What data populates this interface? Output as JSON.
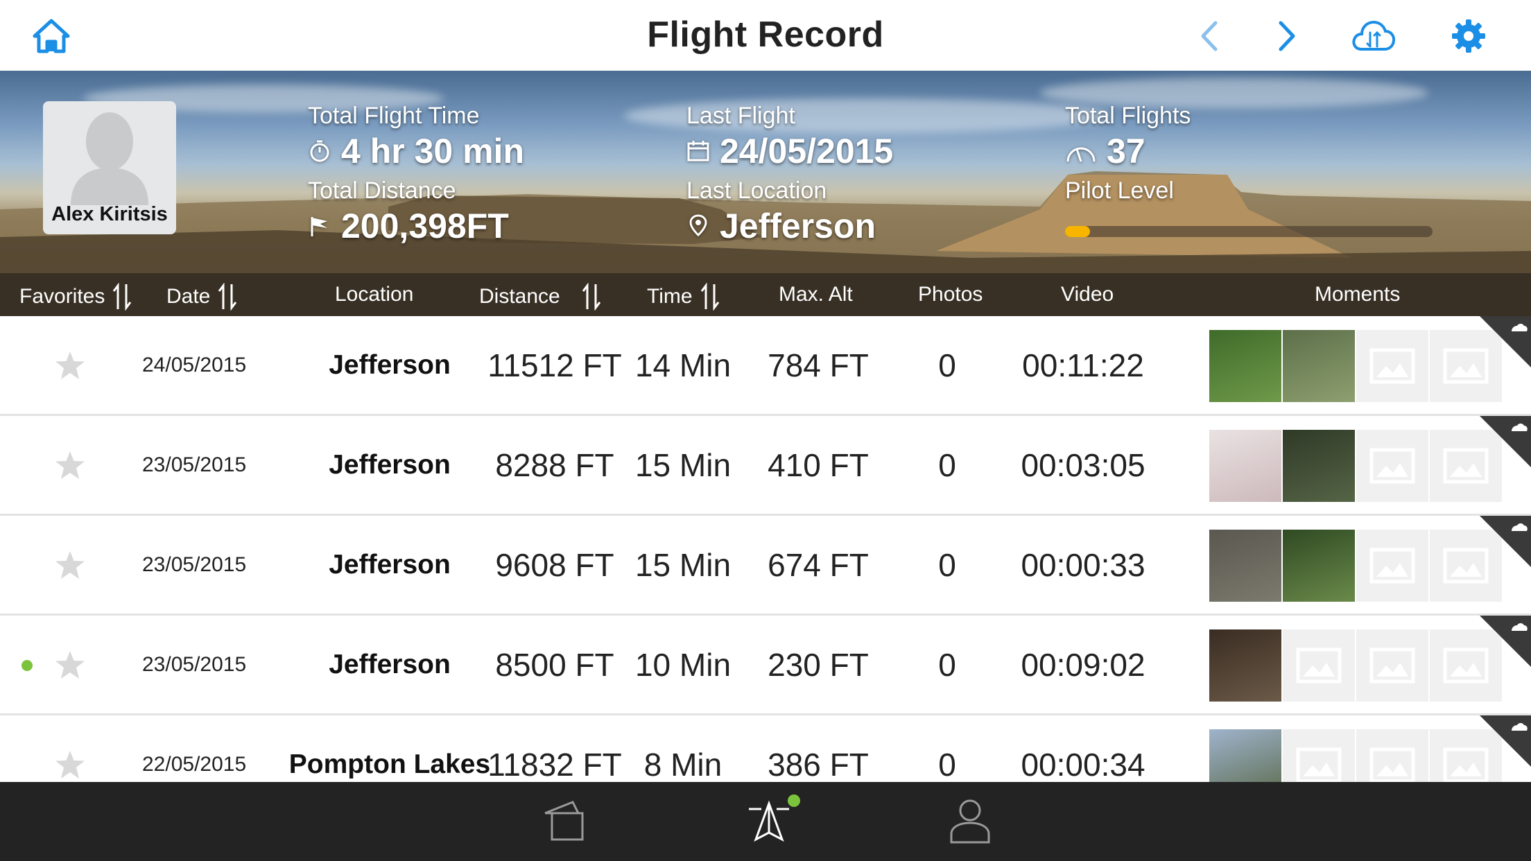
{
  "header": {
    "title": "Flight Record"
  },
  "colors": {
    "accent": "#1b8ee6",
    "pilot_level": "#f7b500",
    "status_green": "#7cc33d",
    "tabbar": "#232323"
  },
  "icons": {
    "home": "home-icon",
    "prev": "chevron-left-icon",
    "next": "chevron-right-icon",
    "cloud": "cloud-sync-icon",
    "settings": "gear-icon"
  },
  "profile": {
    "name": "Alex Kiritsis"
  },
  "stats": {
    "total_flight_time": {
      "label": "Total Flight Time",
      "value": "4 hr 30 min"
    },
    "last_flight": {
      "label": "Last Flight",
      "value": "24/05/2015"
    },
    "total_flights": {
      "label": "Total Flights",
      "value": "37"
    },
    "total_distance": {
      "label": "Total Distance",
      "value": "200,398FT"
    },
    "last_location": {
      "label": "Last Location",
      "value": "Jefferson"
    },
    "pilot_level": {
      "label": "Pilot Level",
      "progress": 0.05
    }
  },
  "columns": {
    "favorites": "Favorites",
    "date": "Date",
    "location": "Location",
    "distance": "Distance",
    "time": "Time",
    "max_alt": "Max. Alt",
    "photos": "Photos",
    "video": "Video",
    "moments": "Moments"
  },
  "rows": [
    {
      "date": "24/05/2015",
      "location": "Jefferson",
      "distance": "11512 FT",
      "time": "14 Min",
      "max_alt": "784 FT",
      "photos": "0",
      "video": "00:11:22",
      "new": false
    },
    {
      "date": "23/05/2015",
      "location": "Jefferson",
      "distance": "8288 FT",
      "time": "15 Min",
      "max_alt": "410 FT",
      "photos": "0",
      "video": "00:03:05",
      "new": false
    },
    {
      "date": "23/05/2015",
      "location": "Jefferson",
      "distance": "9608 FT",
      "time": "15 Min",
      "max_alt": "674 FT",
      "photos": "0",
      "video": "00:00:33",
      "new": false
    },
    {
      "date": "23/05/2015",
      "location": "Jefferson",
      "distance": "8500 FT",
      "time": "10 Min",
      "max_alt": "230 FT",
      "photos": "0",
      "video": "00:09:02",
      "new": true
    },
    {
      "date": "22/05/2015",
      "location": "Pompton Lakes",
      "distance": "11832 FT",
      "time": "8 Min",
      "max_alt": "386 FT",
      "photos": "0",
      "video": "00:00:34",
      "new": false
    }
  ],
  "tabs": [
    {
      "name": "tab-library",
      "icon": "library-icon"
    },
    {
      "name": "tab-fly",
      "icon": "drone-icon",
      "badge": true
    },
    {
      "name": "tab-profile",
      "icon": "profile-icon"
    }
  ]
}
